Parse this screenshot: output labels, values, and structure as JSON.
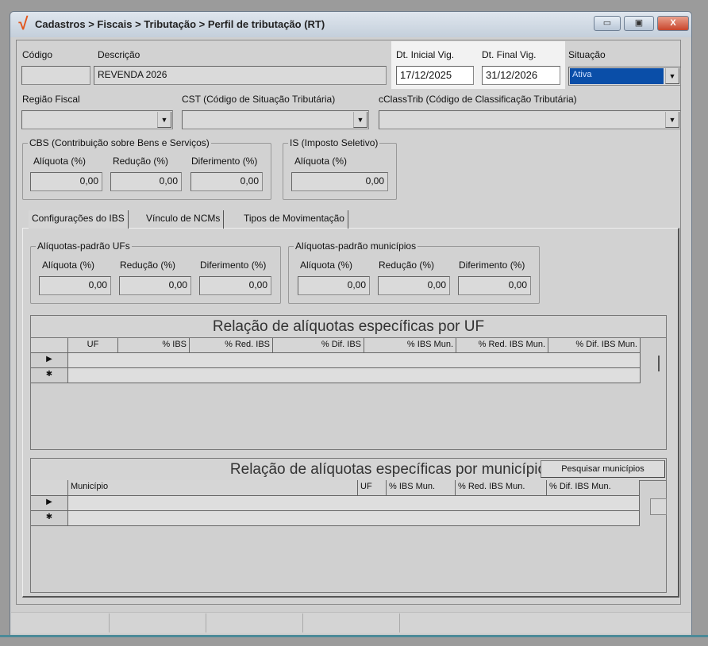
{
  "window": {
    "title": "Cadastros > Fiscais > Tributação > Perfil de tributação (RT)",
    "minimize": "▭",
    "maximize": "▣",
    "close": "X"
  },
  "form": {
    "codigo": {
      "label": "Código",
      "value": ""
    },
    "descricao": {
      "label": "Descrição",
      "value": "REVENDA 2026"
    },
    "dt_inicial": {
      "label": "Dt. Inicial Vig.",
      "value": "17/12/2025"
    },
    "dt_final": {
      "label": "Dt. Final Vig.",
      "value": "31/12/2026"
    },
    "situacao": {
      "label": "Situação",
      "value": "Ativa"
    },
    "regiao_fiscal": {
      "label": "Região Fiscal",
      "value": ""
    },
    "cst": {
      "label": "CST (Código de Situação Tributária)",
      "value": ""
    },
    "cclasstrib": {
      "label": "cClassTrib (Código de Classificação Tributária)",
      "value": ""
    },
    "cbs": {
      "title": "CBS (Contribuição sobre Bens e Serviços)",
      "aliquota_label": "Alíquota (%)",
      "aliquota": "0,00",
      "reducao_label": "Redução (%)",
      "reducao": "0,00",
      "diferimento_label": "Diferimento (%)",
      "diferimento": "0,00"
    },
    "is": {
      "title": "IS (Imposto Seletivo)",
      "aliquota_label": "Alíquota (%)",
      "aliquota": "0,00"
    }
  },
  "tabs": [
    {
      "label": "Configurações do IBS",
      "active": true
    },
    {
      "label": "Vínculo de NCMs"
    },
    {
      "label": "Tipos de Movimentação"
    }
  ],
  "ibs": {
    "ufs": {
      "title": "Alíquotas-padrão UFs",
      "aliquota_label": "Alíquota (%)",
      "aliquota": "0,00",
      "reducao_label": "Redução (%)",
      "reducao": "0,00",
      "diferimento_label": "Diferimento (%)",
      "diferimento": "0,00"
    },
    "municipios": {
      "title": "Alíquotas-padrão municípios",
      "aliquota_label": "Alíquota (%)",
      "aliquota": "0,00",
      "reducao_label": "Redução (%)",
      "reducao": "0,00",
      "diferimento_label": "Diferimento (%)",
      "diferimento": "0,00"
    }
  },
  "grid_uf": {
    "title": "Relação de alíquotas específicas por UF",
    "columns": [
      "UF",
      "% IBS",
      "% Red. IBS",
      "% Dif. IBS",
      "% IBS Mun.",
      "% Red. IBS Mun.",
      "% Dif. IBS Mun."
    ],
    "row_indicators": [
      "▶",
      "✱"
    ]
  },
  "grid_mun": {
    "title": "Relação de alíquotas específicas por município",
    "search_button": "Pesquisar municípios",
    "columns": [
      "Município",
      "UF",
      "% IBS Mun.",
      "% Red. IBS Mun.",
      "% Dif. IBS Mun."
    ],
    "row_indicators": [
      "▶",
      "✱"
    ]
  },
  "colors": {
    "selection": "#0a4ea8",
    "logo": "#e2561c"
  }
}
